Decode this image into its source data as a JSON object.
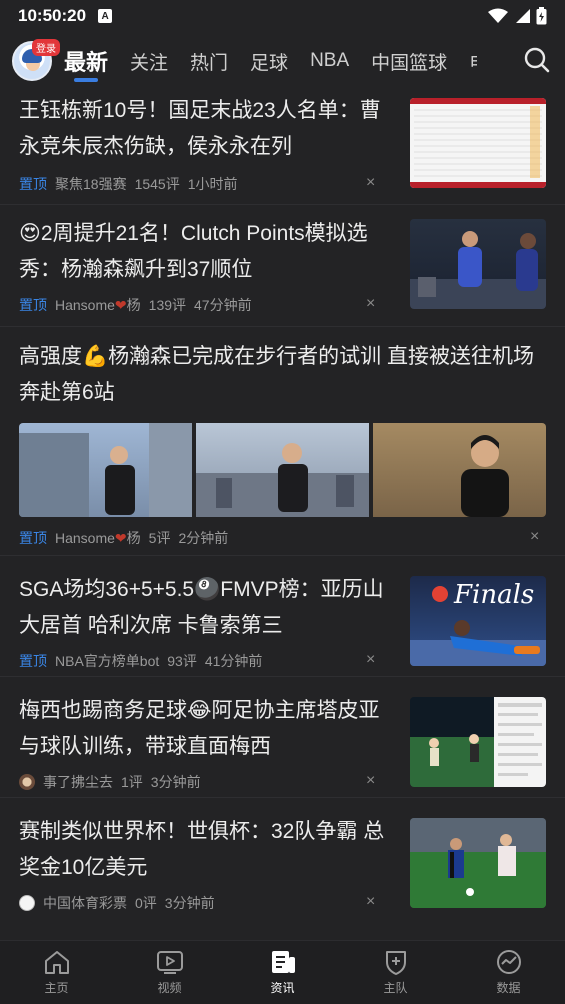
{
  "status_bar": {
    "time": "10:50:20",
    "a_badge": "A"
  },
  "header": {
    "login_badge": "登录",
    "tabs": [
      {
        "label": "最新",
        "active": true
      },
      {
        "label": "关注"
      },
      {
        "label": "热门"
      },
      {
        "label": "足球"
      },
      {
        "label": "NBA"
      },
      {
        "label": "中国篮球"
      },
      {
        "label": "电"
      }
    ]
  },
  "articles": [
    {
      "title_line1": "王钰栋新10号！国足末战23人名单：曹",
      "title_line2": "永竞朱辰杰伤缺，侯永永在列",
      "pin": "置顶",
      "author": "聚焦18强赛",
      "comments": "1545评",
      "time": "1小时前"
    },
    {
      "title_line1": "😍2周提升21名！Clutch Points模拟选",
      "title_line2": "秀：杨瀚森飙升到37顺位",
      "pin": "置顶",
      "author_a": "Hansome",
      "author_b": "杨",
      "comments": "139评",
      "time": "47分钟前"
    },
    {
      "title_line1": "高强度💪杨瀚森已完成在步行者的试训 直接被送往机场",
      "title_line2": "奔赴第6站",
      "pin": "置顶",
      "author_a": "Hansome",
      "author_b": "杨",
      "comments": "5评",
      "time": "2分钟前"
    },
    {
      "title_line1": "SGA场均36+5+5.5🎱FMVP榜：亚历山",
      "title_line2": "大居首 哈利次席 卡鲁索第三",
      "pin": "置顶",
      "author": "NBA官方榜单bot",
      "comments": "93评",
      "time": "41分钟前",
      "thumb_text": "Finals"
    },
    {
      "title_line1": "梅西也踢商务足球😂阿足协主席塔皮亚",
      "title_line2": "与球队训练，带球直面梅西",
      "author": "事了拂尘去",
      "comments": "1评",
      "time": "3分钟前"
    },
    {
      "title_line1": "赛制类似世界杯！世俱杯：32队争霸 总",
      "title_line2": "奖金10亿美元",
      "author": "中国体育彩票",
      "comments": "0评",
      "time": "3分钟前"
    }
  ],
  "bottom_nav": [
    {
      "label": "主页",
      "icon": "home-icon"
    },
    {
      "label": "视频",
      "icon": "video-icon"
    },
    {
      "label": "资讯",
      "icon": "news-icon",
      "active": true
    },
    {
      "label": "主队",
      "icon": "team-shield-icon"
    },
    {
      "label": "数据",
      "icon": "data-chart-icon"
    }
  ],
  "close_symbol": "×",
  "heart_symbol": "❤"
}
